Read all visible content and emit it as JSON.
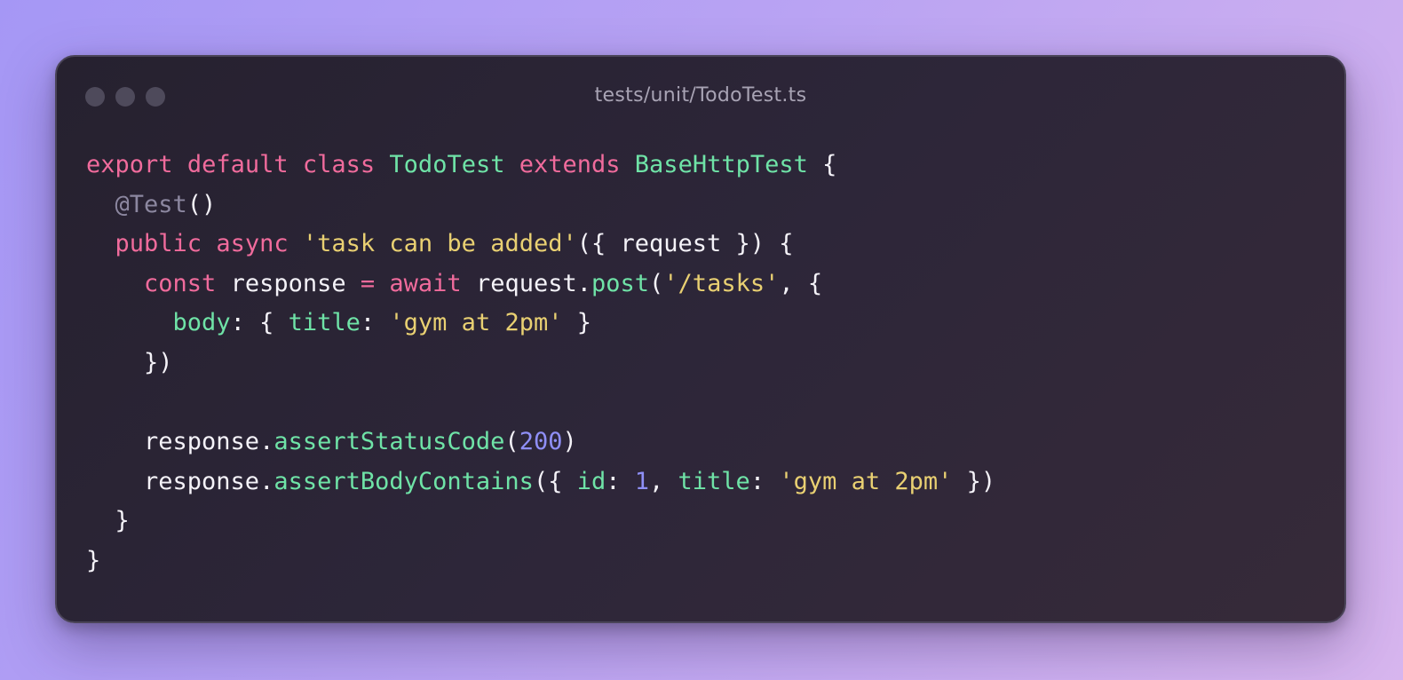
{
  "window": {
    "title": "tests/unit/TodoTest.ts",
    "traffic_lights": [
      "close-dot",
      "minimize-dot",
      "zoom-dot"
    ]
  },
  "colors": {
    "keyword": "#f06b9c",
    "class_name": "#6fe3a7",
    "property": "#6fe3a7",
    "string": "#e9d072",
    "number": "#8f8ff7",
    "decorator": "#8c87a0",
    "plain": "#f4f2f8",
    "window_bg": "#2a2433"
  },
  "code": {
    "language": "typescript",
    "lines": [
      [
        {
          "t": "kw",
          "v": "export"
        },
        {
          "t": "plain",
          "v": " "
        },
        {
          "t": "kw",
          "v": "default"
        },
        {
          "t": "plain",
          "v": " "
        },
        {
          "t": "kw",
          "v": "class"
        },
        {
          "t": "plain",
          "v": " "
        },
        {
          "t": "cls",
          "v": "TodoTest"
        },
        {
          "t": "plain",
          "v": " "
        },
        {
          "t": "kw",
          "v": "extends"
        },
        {
          "t": "plain",
          "v": " "
        },
        {
          "t": "cls",
          "v": "BaseHttpTest"
        },
        {
          "t": "plain",
          "v": " {"
        }
      ],
      [
        {
          "t": "plain",
          "v": "  "
        },
        {
          "t": "deco",
          "v": "@Test"
        },
        {
          "t": "plain",
          "v": "()"
        }
      ],
      [
        {
          "t": "plain",
          "v": "  "
        },
        {
          "t": "kw",
          "v": "public"
        },
        {
          "t": "plain",
          "v": " "
        },
        {
          "t": "kw",
          "v": "async"
        },
        {
          "t": "plain",
          "v": " "
        },
        {
          "t": "str",
          "v": "'task can be added'"
        },
        {
          "t": "plain",
          "v": "({ request }) {"
        }
      ],
      [
        {
          "t": "plain",
          "v": "    "
        },
        {
          "t": "kw",
          "v": "const"
        },
        {
          "t": "plain",
          "v": " response "
        },
        {
          "t": "kw",
          "v": "="
        },
        {
          "t": "plain",
          "v": " "
        },
        {
          "t": "kw",
          "v": "await"
        },
        {
          "t": "plain",
          "v": " request."
        },
        {
          "t": "fn",
          "v": "post"
        },
        {
          "t": "plain",
          "v": "("
        },
        {
          "t": "str",
          "v": "'/tasks'"
        },
        {
          "t": "plain",
          "v": ", {"
        }
      ],
      [
        {
          "t": "plain",
          "v": "      "
        },
        {
          "t": "prop",
          "v": "body"
        },
        {
          "t": "plain",
          "v": ": { "
        },
        {
          "t": "prop",
          "v": "title"
        },
        {
          "t": "plain",
          "v": ": "
        },
        {
          "t": "str",
          "v": "'gym at 2pm'"
        },
        {
          "t": "plain",
          "v": " }"
        }
      ],
      [
        {
          "t": "plain",
          "v": "    })"
        }
      ],
      [],
      [
        {
          "t": "plain",
          "v": "    response."
        },
        {
          "t": "fn",
          "v": "assertStatusCode"
        },
        {
          "t": "plain",
          "v": "("
        },
        {
          "t": "num",
          "v": "200"
        },
        {
          "t": "plain",
          "v": ")"
        }
      ],
      [
        {
          "t": "plain",
          "v": "    response."
        },
        {
          "t": "fn",
          "v": "assertBodyContains"
        },
        {
          "t": "plain",
          "v": "({ "
        },
        {
          "t": "prop",
          "v": "id"
        },
        {
          "t": "plain",
          "v": ": "
        },
        {
          "t": "num",
          "v": "1"
        },
        {
          "t": "plain",
          "v": ", "
        },
        {
          "t": "prop",
          "v": "title"
        },
        {
          "t": "plain",
          "v": ": "
        },
        {
          "t": "str",
          "v": "'gym at 2pm'"
        },
        {
          "t": "plain",
          "v": " })"
        }
      ],
      [
        {
          "t": "plain",
          "v": "  }"
        }
      ],
      [
        {
          "t": "plain",
          "v": "}"
        }
      ]
    ]
  }
}
